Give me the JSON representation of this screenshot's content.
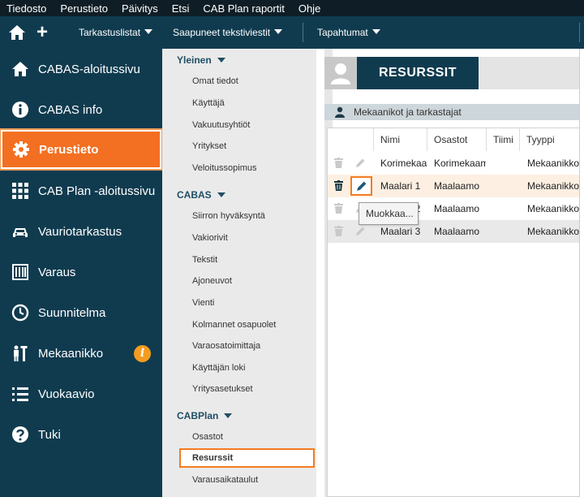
{
  "menubar": {
    "items": [
      "Tiedosto",
      "Perustieto",
      "Päivitys",
      "Etsi",
      "CAB Plan raportit",
      "Ohje"
    ]
  },
  "toolbar": {
    "home_icon": "home-icon",
    "add_icon": "plus-icon",
    "menus": [
      "Tarkastuslistat",
      "Saapuneet tekstiviestit",
      "Tapahtumat"
    ]
  },
  "sidebar": {
    "items": [
      {
        "label": "CABAS-aloitussivu",
        "icon": "home-icon"
      },
      {
        "label": "CABAS info",
        "icon": "info-icon"
      },
      {
        "label": "Perustieto",
        "icon": "gear-icon"
      },
      {
        "label": "CAB Plan -aloitussivu",
        "icon": "grid-icon"
      },
      {
        "label": "Vauriotarkastus",
        "icon": "car-icon"
      },
      {
        "label": "Varaus",
        "icon": "calendar-icon"
      },
      {
        "label": "Suunnitelma",
        "icon": "clock-icon"
      },
      {
        "label": "Mekaanikko",
        "icon": "mechanic-icon"
      },
      {
        "label": "Vuokaavio",
        "icon": "list-icon"
      },
      {
        "label": "Tuki",
        "icon": "question-icon"
      }
    ],
    "active_index": 2,
    "accent": "#f36f21"
  },
  "subnav": {
    "sections": [
      {
        "title": "Yleinen",
        "items": [
          "Omat tiedot",
          "Käyttäjä",
          "Vakuutusyhtiöt",
          "Yritykset",
          "Veloitussopimus"
        ]
      },
      {
        "title": "CABAS",
        "items": [
          "Siirron hyväksyntä",
          "Vakiorivit",
          "Tekstit",
          "Ajoneuvot",
          "Vienti",
          "Kolmannet osapuolet",
          "Varaosatoimittaja",
          "Käyttäjän loki",
          "Yritysasetukset"
        ]
      },
      {
        "title": "CABPlan",
        "items": [
          "Osastot",
          "Resurssit",
          "Varausaikataulut"
        ]
      }
    ],
    "active_item": "Resurssit"
  },
  "main": {
    "title": "RESURSSIT",
    "section_label": "Mekaanikot ja tarkastajat",
    "columns": [
      "Nimi",
      "Osastot",
      "Tiimi",
      "Tyyppi"
    ],
    "rows": [
      {
        "name": "Korimekaanikko",
        "dept": "Korimekaamo",
        "team": "",
        "type": "Mekaanikko"
      },
      {
        "name": "Maalari 1",
        "dept": "Maalaamo",
        "team": "",
        "type": "Mekaanikko"
      },
      {
        "name": "Maalari 2",
        "dept": "Maalaamo",
        "team": "",
        "type": "Mekaanikko"
      },
      {
        "name": "Maalari 3",
        "dept": "Maalaamo",
        "team": "",
        "type": "Mekaanikko"
      }
    ],
    "tooltip": "Muokkaa..."
  }
}
